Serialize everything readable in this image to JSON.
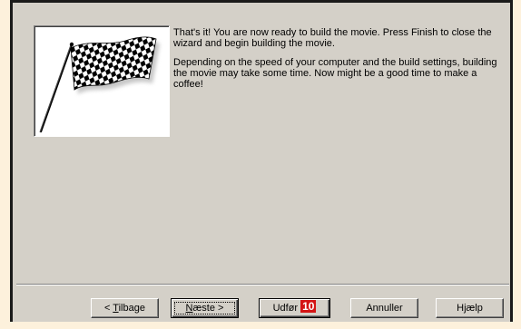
{
  "wizard": {
    "paragraph1": "That's it! You are now ready to build the movie. Press Finish to close the wizard and begin building the movie.",
    "paragraph2": "Depending on the speed of your computer and the build settings, building the movie may take some time. Now might be a good time to make a coffee!"
  },
  "buttons": {
    "back_prefix": "< ",
    "back_hotkey": "T",
    "back_rest": "ilbage",
    "next_hotkey": "N",
    "next_rest": "æste >",
    "finish_label": "Udfør",
    "finish_badge": "10",
    "cancel_label": "Annuller",
    "help_label": "Hjælp"
  },
  "icons": {
    "illustration": "checkered-flag-icon"
  },
  "colors": {
    "dialog_bg": "#d4d0c8",
    "outer_bg": "#fdf1dc",
    "badge": "#d41414"
  }
}
